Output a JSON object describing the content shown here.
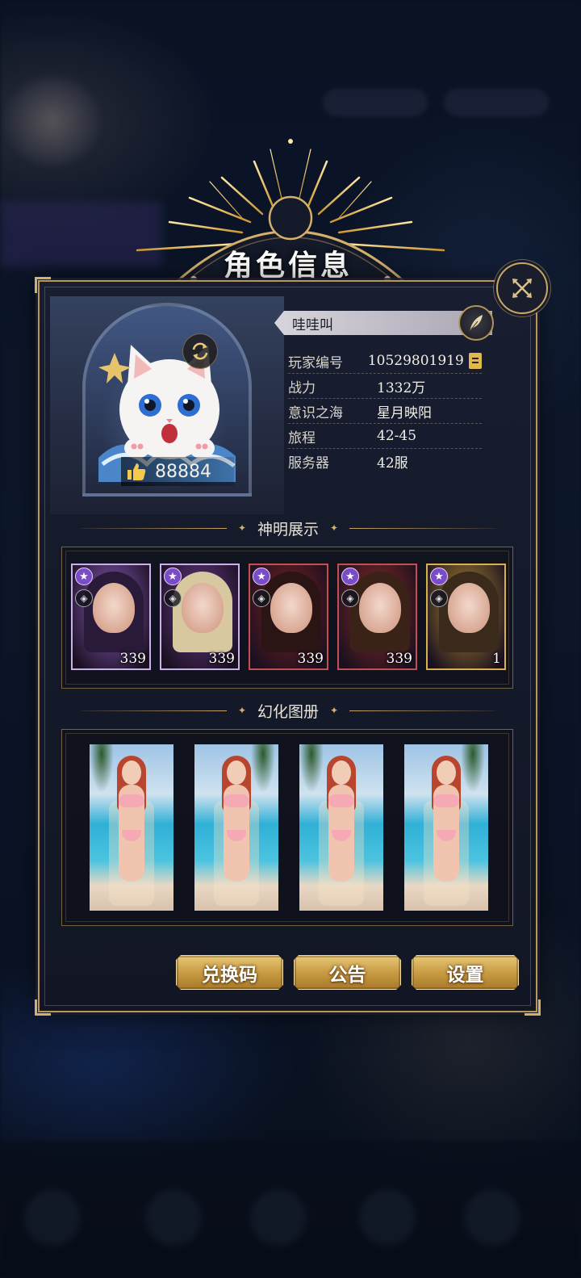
{
  "title": "角色信息",
  "profile": {
    "name": "哇哇叫",
    "likes": "88884",
    "fields": [
      {
        "label": "玩家编号",
        "value": "10529801919"
      },
      {
        "label": "战力",
        "value": "1332万"
      },
      {
        "label": "意识之海",
        "value": "星月映阳"
      },
      {
        "label": "旅程",
        "value": "42-45"
      },
      {
        "label": "服务器",
        "value": "42服"
      }
    ]
  },
  "sections": {
    "gods": "神明展示",
    "gallery": "幻化图册"
  },
  "god_cards": [
    {
      "level": "339",
      "frame": "#c8b0e8",
      "bg": "#8a5cc0",
      "hair": "#2a1a3a"
    },
    {
      "level": "339",
      "frame": "#c8b0e8",
      "bg": "#6a3a8a",
      "hair": "#d8c8a0"
    },
    {
      "level": "339",
      "frame": "#c25050",
      "bg": "#7a2020",
      "hair": "#2a1414"
    },
    {
      "level": "339",
      "frame": "#c25050",
      "bg": "#8a2a24",
      "hair": "#3a2218"
    },
    {
      "level": "1",
      "frame": "#d8b050",
      "bg": "#b08a30",
      "hair": "#3a2a1c"
    }
  ],
  "gallery_count": 4,
  "buttons": {
    "redeem": "兑换码",
    "notice": "公告",
    "settings": "设置"
  },
  "colors": {
    "gold": "#c9a766",
    "panel": "#181e30",
    "button_gold": "#c99c44"
  }
}
